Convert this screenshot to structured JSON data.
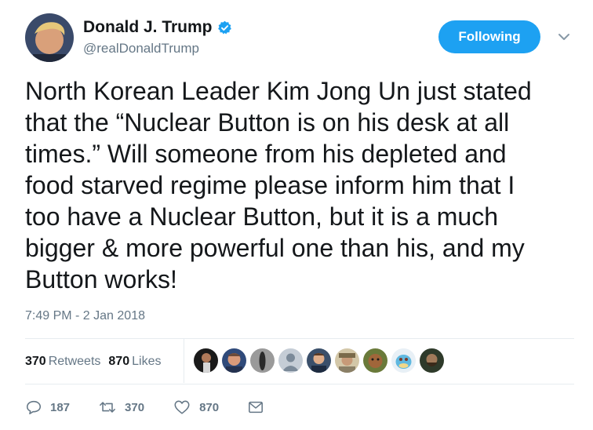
{
  "header": {
    "display_name": "Donald J. Trump",
    "handle": "@realDonaldTrump",
    "follow_label": "Following",
    "verified_icon": "verified-badge-icon",
    "menu_icon": "chevron-down-icon"
  },
  "tweet": {
    "text": "North Korean Leader Kim Jong Un just stated\nthat the “Nuclear Button is on his desk at all\ntimes.” Will someone from his depleted and\nfood starved regime please inform him that I\ntoo have a Nuclear Button, but it is a much\nbigger & more powerful one than his, and my\nButton works!",
    "timestamp": "7:49 PM - 2 Jan 2018"
  },
  "stats": {
    "retweets_count": "370",
    "retweets_label": "Retweets",
    "likes_count": "870",
    "likes_label": "Likes"
  },
  "likers": [
    {
      "icon": "user-avatar-1"
    },
    {
      "icon": "user-avatar-2"
    },
    {
      "icon": "user-avatar-3"
    },
    {
      "icon": "default-avatar-icon"
    },
    {
      "icon": "user-avatar-5"
    },
    {
      "icon": "user-avatar-6"
    },
    {
      "icon": "user-avatar-7"
    },
    {
      "icon": "user-avatar-8"
    },
    {
      "icon": "user-avatar-9"
    }
  ],
  "actions": {
    "reply_count": "187",
    "retweet_count": "370",
    "like_count": "870",
    "reply_icon": "reply-icon",
    "retweet_icon": "retweet-icon",
    "like_icon": "heart-icon",
    "dm_icon": "envelope-icon"
  },
  "colors": {
    "accent": "#1da1f2",
    "text_primary": "#14171a",
    "text_secondary": "#657786",
    "divider": "#e6ecf0"
  }
}
